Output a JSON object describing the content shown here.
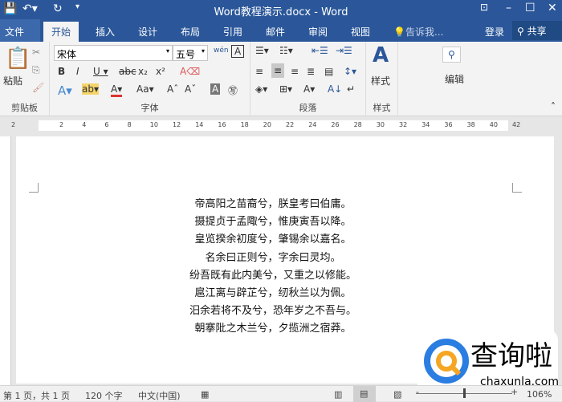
{
  "title": "Word教程演示.docx - Word",
  "tabs": {
    "file": "文件",
    "items": [
      "开始",
      "插入",
      "设计",
      "布局",
      "引用",
      "邮件",
      "审阅",
      "视图"
    ],
    "tell": "告诉我...",
    "login": "登录",
    "share": "共享"
  },
  "ribbon": {
    "paste": "粘贴",
    "clipboard": "剪贴板",
    "font_name": "宋体",
    "font_size": "五号",
    "font_group": "字体",
    "para_group": "段落",
    "styles": "样式",
    "styles_group": "样式",
    "editing": "编辑"
  },
  "ruler": [
    "2",
    "2",
    "4",
    "6",
    "8",
    "10",
    "12",
    "14",
    "16",
    "18",
    "20",
    "22",
    "24",
    "26",
    "28",
    "30",
    "32",
    "34",
    "36",
    "38",
    "40",
    "42"
  ],
  "poem": [
    "帝高阳之苗裔兮，朕皇考曰伯庸。",
    "摄提贞于孟陬兮，惟庚寅吾以降。",
    "皇览揆余初度兮，肇锡余以嘉名。",
    "名余曰正则兮，字余曰灵均。",
    "纷吾既有此内美兮，又重之以修能。",
    "扈江离与辟芷兮，纫秋兰以为佩。",
    "汨余若将不及兮，恐年岁之不吾与。",
    "朝搴阰之木兰兮，夕揽洲之宿莽。"
  ],
  "status": {
    "page": "第 1 页，共 1 页",
    "words": "120 个字",
    "lang": "中文(中国)",
    "zoom": "106%"
  },
  "watermark": {
    "name": "查询啦",
    "url": "chaxunla.com"
  },
  "colors": {
    "brand": "#2b579a"
  }
}
